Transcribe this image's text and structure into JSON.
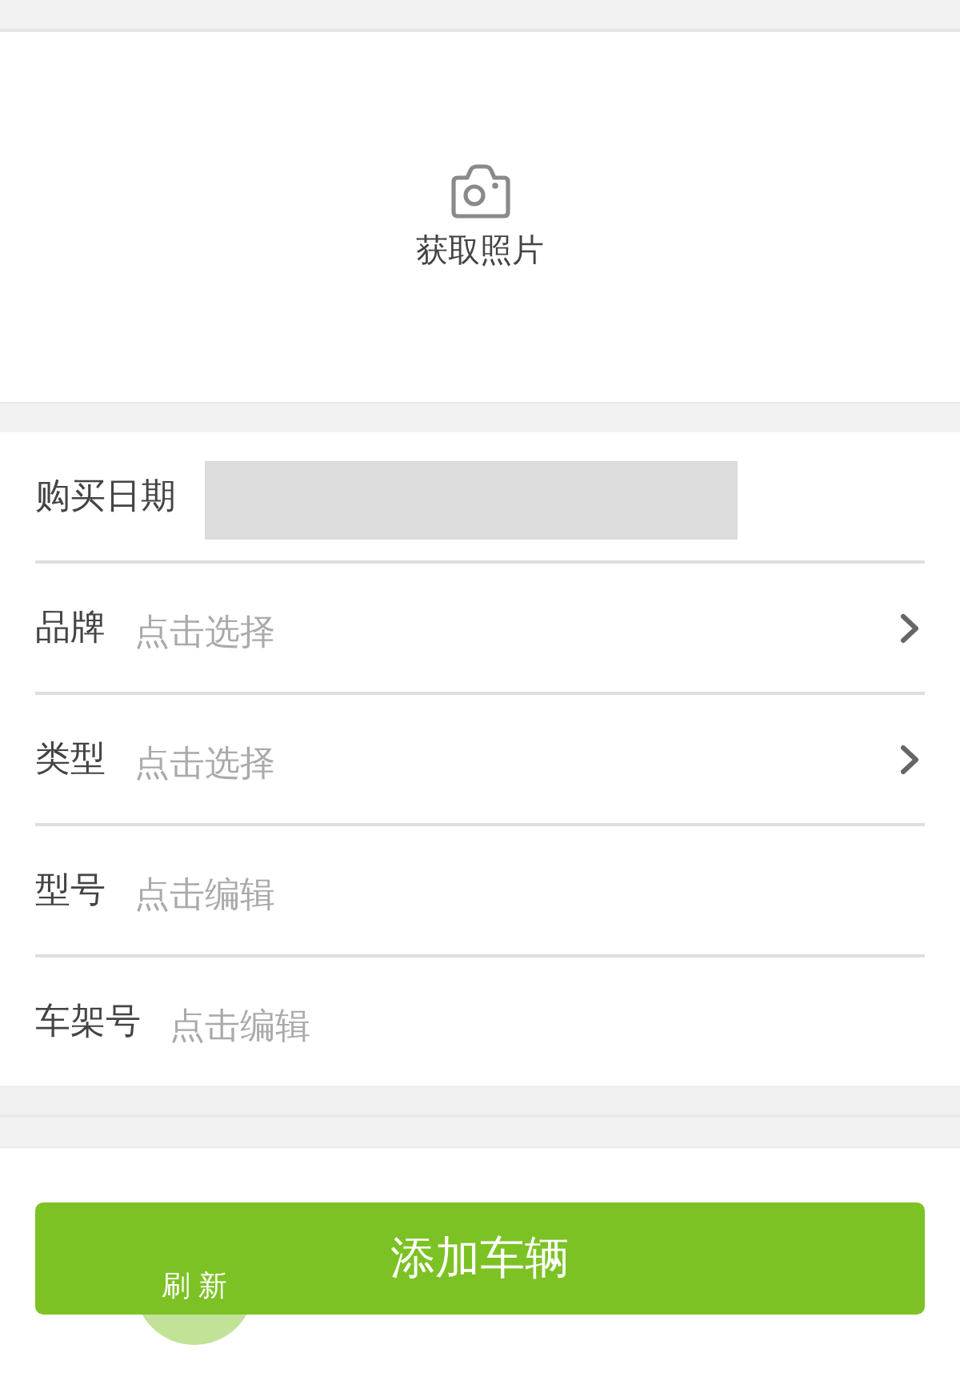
{
  "photo": {
    "label": "获取照片"
  },
  "fields": [
    {
      "kind": "date",
      "label": "购买日期"
    },
    {
      "kind": "select",
      "label": "品牌",
      "placeholder": "点击选择"
    },
    {
      "kind": "select",
      "label": "类型",
      "placeholder": "点击选择"
    },
    {
      "kind": "edit",
      "label": "型号",
      "placeholder": "点击编辑"
    },
    {
      "kind": "edit",
      "label": "车架号",
      "placeholder": "点击编辑"
    }
  ],
  "submit_button": {
    "label": "添加车辆"
  },
  "refresh_button": {
    "label": "刷新"
  }
}
